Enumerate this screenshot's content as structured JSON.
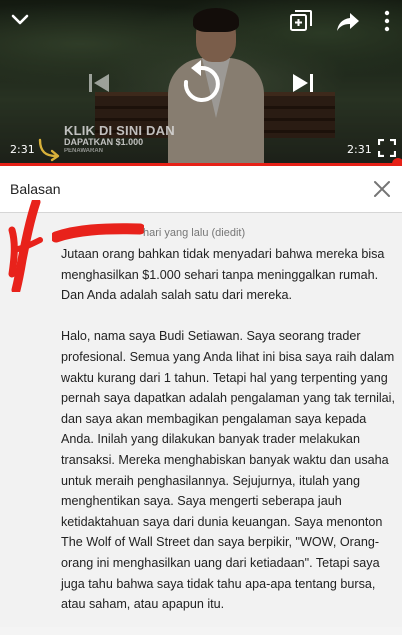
{
  "player": {
    "time_current": "2:31",
    "time_duration": "2:31",
    "progress": 1.0,
    "promo": {
      "line1": "KLIK DI SINI DAN",
      "line2": "DAPATKAN $1.000",
      "line3": "PENAWARAN"
    },
    "icons": {
      "collapse": "chevron-down-icon",
      "add_to_playlist": "playlist-add-icon",
      "share": "share-icon",
      "more": "more-vert-icon",
      "previous": "skip-previous-icon",
      "replay": "replay-icon",
      "next": "skip-next-icon",
      "fullscreen": "fullscreen-icon"
    },
    "colors": {
      "progress": "#e62117"
    }
  },
  "reply_panel": {
    "title": "Balasan",
    "close_icon": "close-icon"
  },
  "comment": {
    "meta": "hari yang lalu (diedit)",
    "paragraphs": [
      "Jutaan orang bahkan tidak menyadari bahwa mereka bisa menghasilkan $1.000 sehari tanpa meninggalkan rumah. Dan Anda adalah salah satu dari mereka.",
      "Halo, nama saya Budi Setiawan. Saya seorang trader profesional. Semua yang Anda lihat ini bisa saya raih dalam waktu kurang dari 1 tahun. Tetapi hal yang terpenting yang pernah saya dapatkan adalah pengalaman yang tak ternilai, dan saya akan membagikan pengalaman saya kepada Anda. Inilah yang dilakukan banyak trader melakukan transaksi. Mereka menghabiskan banyak waktu dan usaha untuk meraih penghasilannya. Sejujurnya, itulah yang menghentikan saya. Saya mengerti seberapa jauh ketidaktahuan saya dari dunia keuangan. Saya menonton The Wolf of Wall Street dan saya berpikir, \"WOW, Orang-orang ini menghasilkan uang dari ketiadaan\". Tetapi saya juga tahu bahwa saya tidak tahu apa-apa tentang bursa, atau saham, atau apapun itu."
    ],
    "scribble_color": "#e8221b"
  }
}
